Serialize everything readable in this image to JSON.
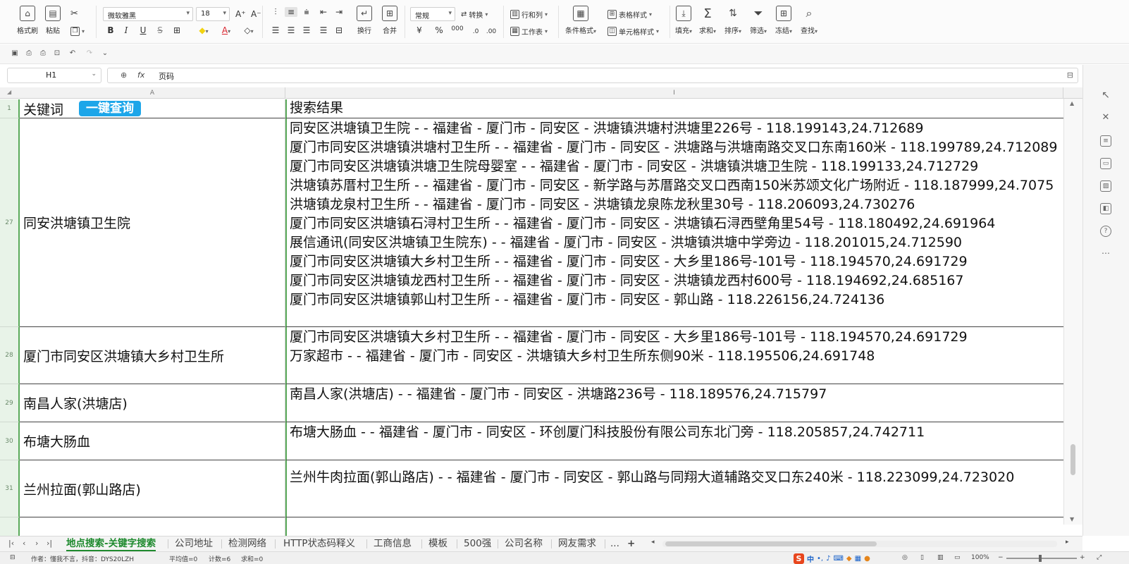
{
  "ribbon": {
    "clipboard": {
      "format_painter": "格式刷",
      "paste": "粘贴",
      "cut_icon": "scissors-icon",
      "copy_icon": "copy-icon"
    },
    "font": {
      "name": "微软雅黑",
      "size": "18",
      "bold": "B",
      "italic": "I",
      "underline": "U",
      "strike": "S",
      "font_color": "#d9232d",
      "fill_color": "#f2d311"
    },
    "alignment": {
      "wrap": "换行",
      "merge": "合并"
    },
    "number": {
      "format": "常规",
      "convert": "转换",
      "currency": "¥",
      "percent": "%",
      "thousands": "000"
    },
    "rows_cols": {
      "rows_cols": "行和列",
      "worksheet": "工作表"
    },
    "styles": {
      "conditional_format": "条件格式",
      "table_style": "表格样式",
      "cell_style": "单元格样式"
    },
    "editing": {
      "fill": "填充",
      "sum": "求和",
      "sort": "排序",
      "filter": "筛选",
      "freeze": "冻结",
      "find": "查找"
    }
  },
  "formula_bar": {
    "cell_ref": "H1",
    "fx": "fx",
    "content": "页码"
  },
  "columns": {
    "a": "A",
    "i": "I"
  },
  "header_row": {
    "row_num": "1",
    "keyword_label": "关键词",
    "query_button": "一键查询",
    "result_label": "搜索结果"
  },
  "rows": [
    {
      "row_num": "27",
      "keyword": "同安洪塘镇卫生院",
      "results": [
        "同安区洪塘镇卫生院 - - 福建省 - 厦门市 - 同安区 - 洪塘镇洪塘村洪塘里226号 - 118.199143,24.712689",
        "厦门市同安区洪塘镇洪塘村卫生所 - - 福建省 - 厦门市 - 同安区 - 洪塘路与洪塘南路交叉口东南160米 - 118.199789,24.712089",
        "厦门市同安区洪塘镇洪塘卫生院母婴室 - - 福建省 - 厦门市 - 同安区 - 洪塘镇洪塘卫生院 - 118.199133,24.712729",
        "洪塘镇苏厝村卫生所 - - 福建省 - 厦门市 - 同安区 - 新学路与苏厝路交叉口西南150米苏颂文化广场附近 - 118.187999,24.7075",
        "洪塘镇龙泉村卫生所 - - 福建省 - 厦门市 - 同安区 - 洪塘镇龙泉陈龙秋里30号 - 118.206093,24.730276",
        "厦门市同安区洪塘镇石浔村卫生所 - - 福建省 - 厦门市 - 同安区 - 洪塘镇石浔西壁角里54号 - 118.180492,24.691964",
        "展信通讯(同安区洪塘镇卫生院东) - - 福建省 - 厦门市 - 同安区 - 洪塘镇洪塘中学旁边 - 118.201015,24.712590",
        "厦门市同安区洪塘镇大乡村卫生所 - - 福建省 - 厦门市 - 同安区 - 大乡里186号-101号 - 118.194570,24.691729",
        "厦门市同安区洪塘镇龙西村卫生所 - - 福建省 - 厦门市 - 同安区 - 洪塘镇龙西村600号 - 118.194692,24.685167",
        "厦门市同安区洪塘镇郭山村卫生所 - - 福建省 - 厦门市 - 同安区 - 郭山路 - 118.226156,24.724136"
      ]
    },
    {
      "row_num": "28",
      "keyword": "厦门市同安区洪塘镇大乡村卫生所",
      "results": [
        "厦门市同安区洪塘镇大乡村卫生所 - - 福建省 - 厦门市 - 同安区 - 大乡里186号-101号 - 118.194570,24.691729",
        "万家超市 - - 福建省 - 厦门市 - 同安区 - 洪塘镇大乡村卫生所东侧90米 - 118.195506,24.691748"
      ]
    },
    {
      "row_num": "29",
      "keyword": "南昌人家(洪塘店)",
      "results": [
        "南昌人家(洪塘店) - - 福建省 - 厦门市 - 同安区 - 洪塘路236号 - 118.189576,24.715797"
      ]
    },
    {
      "row_num": "30",
      "keyword": "布塘大肠血",
      "results": [
        "布塘大肠血 - - 福建省 - 厦门市 - 同安区 - 环创厦门科技股份有限公司东北门旁 - 118.205857,24.742711"
      ]
    },
    {
      "row_num": "31",
      "keyword": "兰州拉面(郭山路店)",
      "results": [
        "兰州牛肉拉面(郭山路店) - - 福建省 - 厦门市 - 同安区 - 郭山路与同翔大道辅路交叉口东240米 - 118.223099,24.723020"
      ]
    }
  ],
  "sheet_tabs": [
    {
      "label": "地点搜索-关键字搜索",
      "active": true
    },
    {
      "label": "公司地址",
      "active": false
    },
    {
      "label": "检测网络",
      "active": false
    },
    {
      "label": "HTTP状态码释义",
      "active": false
    },
    {
      "label": "工商信息",
      "active": false
    },
    {
      "label": "模板",
      "active": false
    },
    {
      "label": "500强",
      "active": false
    },
    {
      "label": "公司名称",
      "active": false
    },
    {
      "label": "网友需求",
      "active": false
    }
  ],
  "tab_more": "...",
  "tab_add": "+",
  "status": {
    "author": "作者：懂我不言，抖音：DYS20LZH",
    "average": "平均值=0",
    "count": "计数=6",
    "sum": "求和=0",
    "zoom": "100%",
    "ime_lang": "中"
  }
}
